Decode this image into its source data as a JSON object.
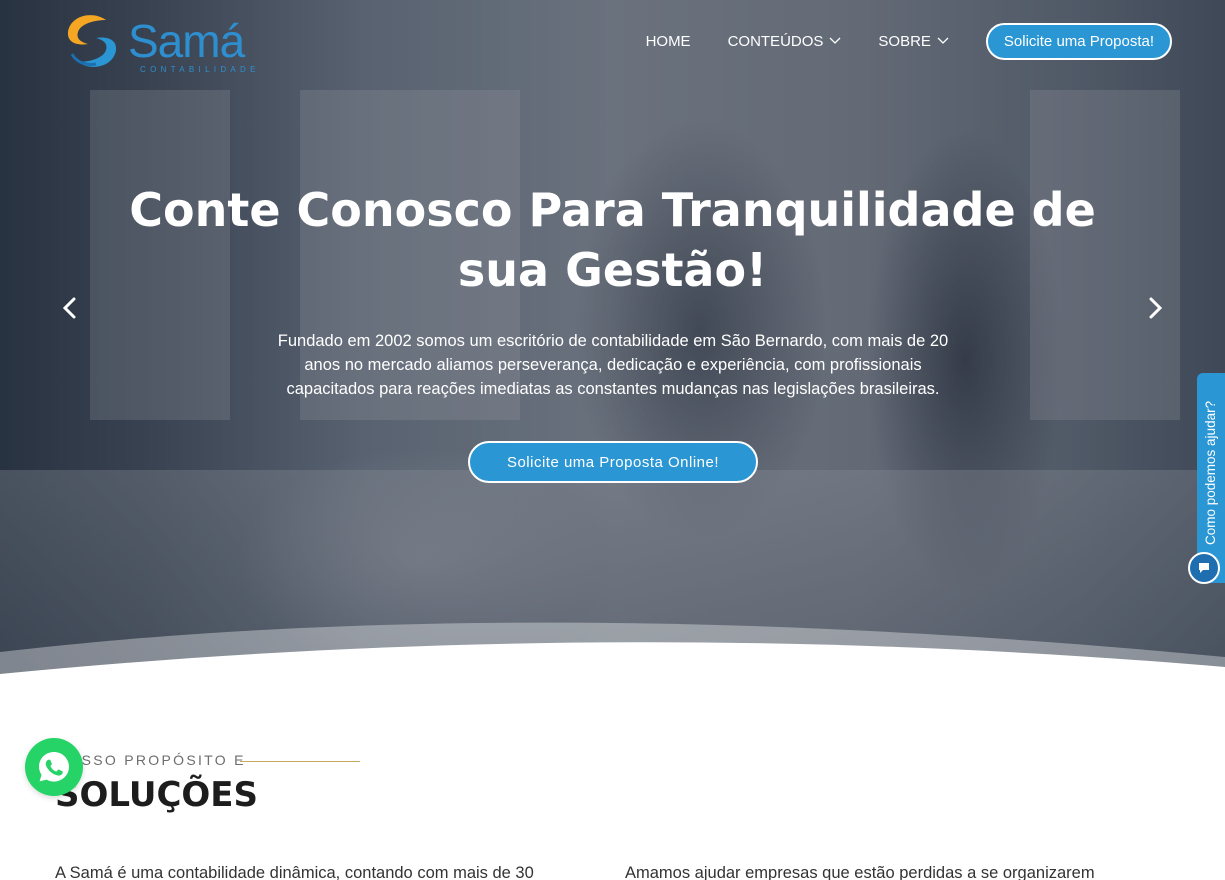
{
  "brand": {
    "name": "Samá",
    "tagline": "CONTABILIDADE",
    "primary_color": "#2a96d4",
    "accent_orange": "#f5a623"
  },
  "nav": {
    "items": [
      {
        "label": "HOME"
      },
      {
        "label": "CONTEÚDOS",
        "icon": "chevron-down-icon"
      },
      {
        "label": "SOBRE",
        "icon": "chevron-down-icon"
      }
    ],
    "cta_label": "Solicite uma Proposta!"
  },
  "hero": {
    "title": "Conte Conosco Para Tranquilidade de sua Gestão!",
    "text": "Fundado em 2002 somos um escritório de contabilidade em São Bernardo, com mais de 20 anos no mercado aliamos perseverança, dedicação e experiência, com profissionais capacitados para reações imediatas as constantes mudanças nas legislações brasileiras.",
    "cta_label": "Solicite uma Proposta Online!"
  },
  "help_widget": {
    "label": "Como podemos ajudar?"
  },
  "section": {
    "kicker": "NOSSO PROPÓSITO E",
    "title": "SOLUÇÕES",
    "para_left": "A Samá é uma contabilidade dinâmica, contando com mais de 30",
    "para_right": "Amamos ajudar empresas que estão perdidas a se organizarem"
  }
}
